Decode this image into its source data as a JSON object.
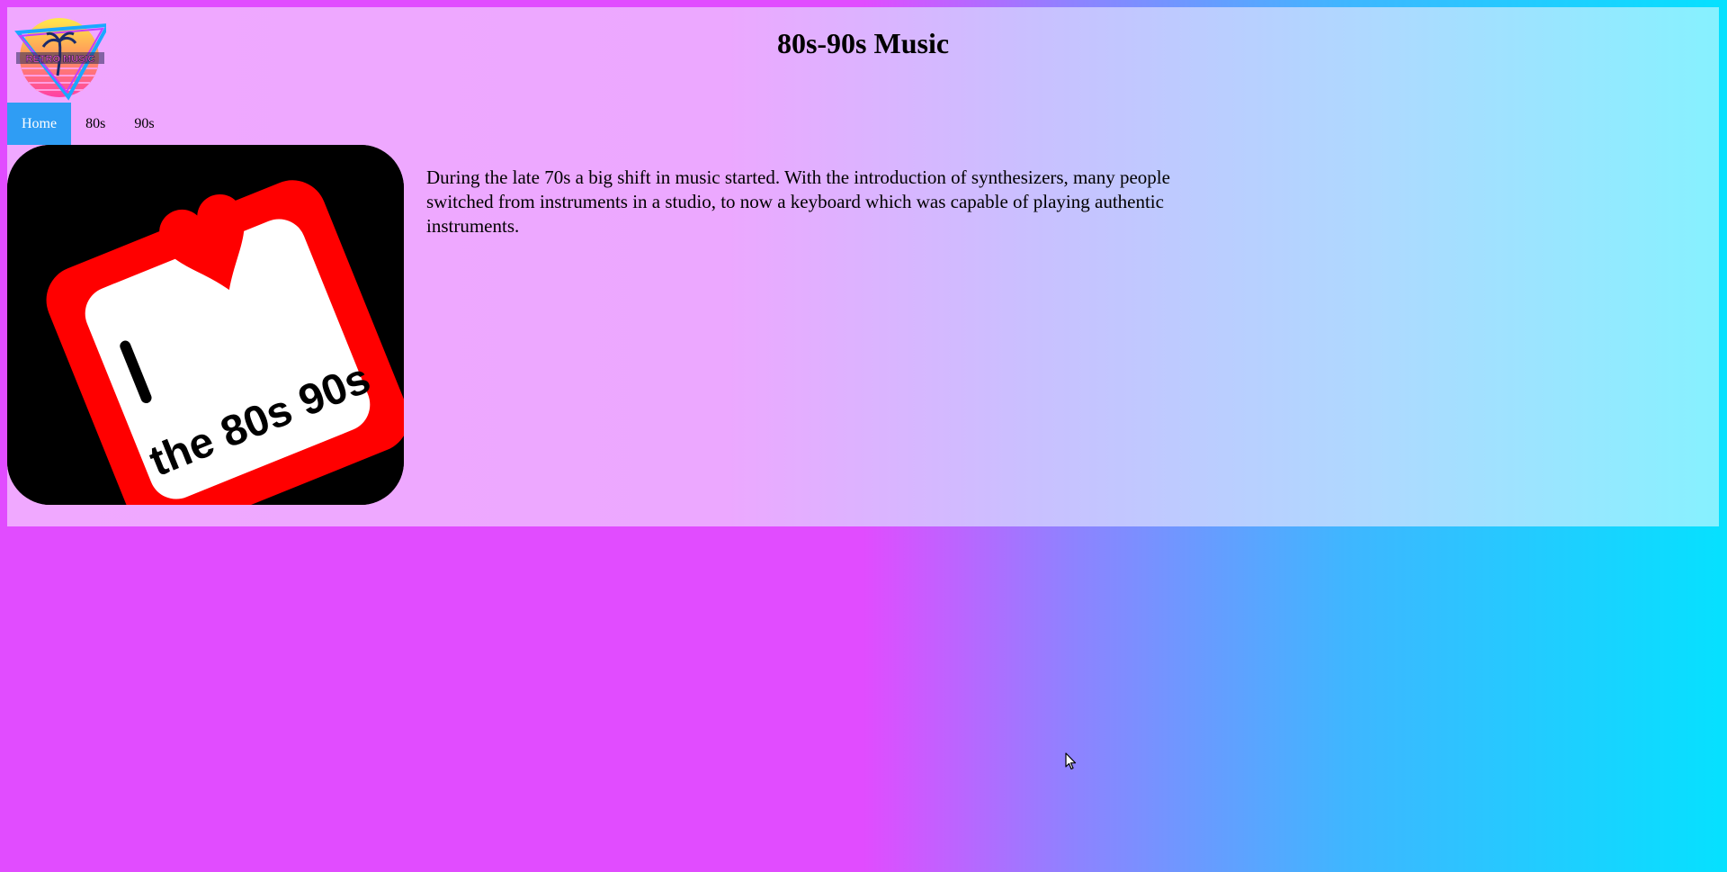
{
  "header": {
    "title": "80s-90s Music",
    "logo": {
      "icon": "retro-music-logo",
      "text": "RETRO MUSIC"
    }
  },
  "nav": {
    "items": [
      {
        "label": "Home",
        "active": true
      },
      {
        "label": "80s",
        "active": false
      },
      {
        "label": "90s",
        "active": false
      }
    ]
  },
  "main": {
    "image": {
      "icon": "i-love-80s-90s-image",
      "letter": "I",
      "text": "the 80s 90s"
    },
    "intro": "During the late 70s a big shift in music started. With the introduction of synthesizers, many people switched from instruments in a studio, to now a keyboard which was capable of playing authentic instruments."
  },
  "colors": {
    "nav_active": "#2f9df4",
    "background_left": "#e14cff",
    "background_right": "#05e1ff",
    "heart": "#ff0000",
    "badge_border": "#ff0000"
  }
}
